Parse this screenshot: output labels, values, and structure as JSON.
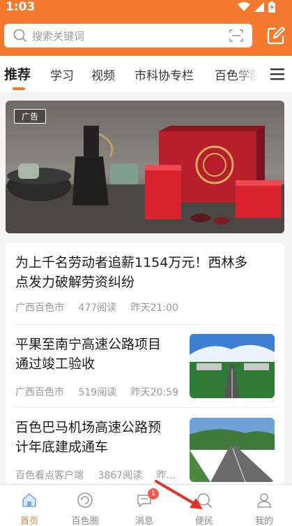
{
  "status_bar": {
    "time": "1:03"
  },
  "search": {
    "placeholder": "搜索关键词"
  },
  "tabs": [
    {
      "label": "推荐",
      "active": true
    },
    {
      "label": "学习"
    },
    {
      "label": "视频"
    },
    {
      "label": "市科协专栏"
    },
    {
      "label": "百色学院"
    }
  ],
  "ad": {
    "tag": "广告"
  },
  "feed": [
    {
      "title_lines": [
        "为上千名劳动者追薪1154万元！西林多",
        "点发力破解劳资纠纷"
      ],
      "source": "广西百色市",
      "reads": "477阅读",
      "time": "昨天21:00"
    },
    {
      "title_lines": [
        "平果至南宁高速公路项目",
        "通过竣工验收"
      ],
      "source": "广西百色市",
      "reads": "519阅读",
      "time": "昨天20:59"
    },
    {
      "title_lines": [
        "百色巴马机场高速公路预",
        "计年底建成通车"
      ],
      "source": "百色看点客户端",
      "reads": "3867阅读",
      "time": "昨..."
    }
  ],
  "nav": [
    {
      "label": "首页",
      "icon": "home-icon",
      "active": true
    },
    {
      "label": "百色圈",
      "icon": "circle-icon"
    },
    {
      "label": "消息",
      "icon": "message-icon",
      "badge": "1"
    },
    {
      "label": "便民",
      "icon": "search-service-icon"
    },
    {
      "label": "我的",
      "icon": "user-icon"
    }
  ],
  "colors": {
    "accent": "#f4792f",
    "badge": "#f25a4f"
  }
}
